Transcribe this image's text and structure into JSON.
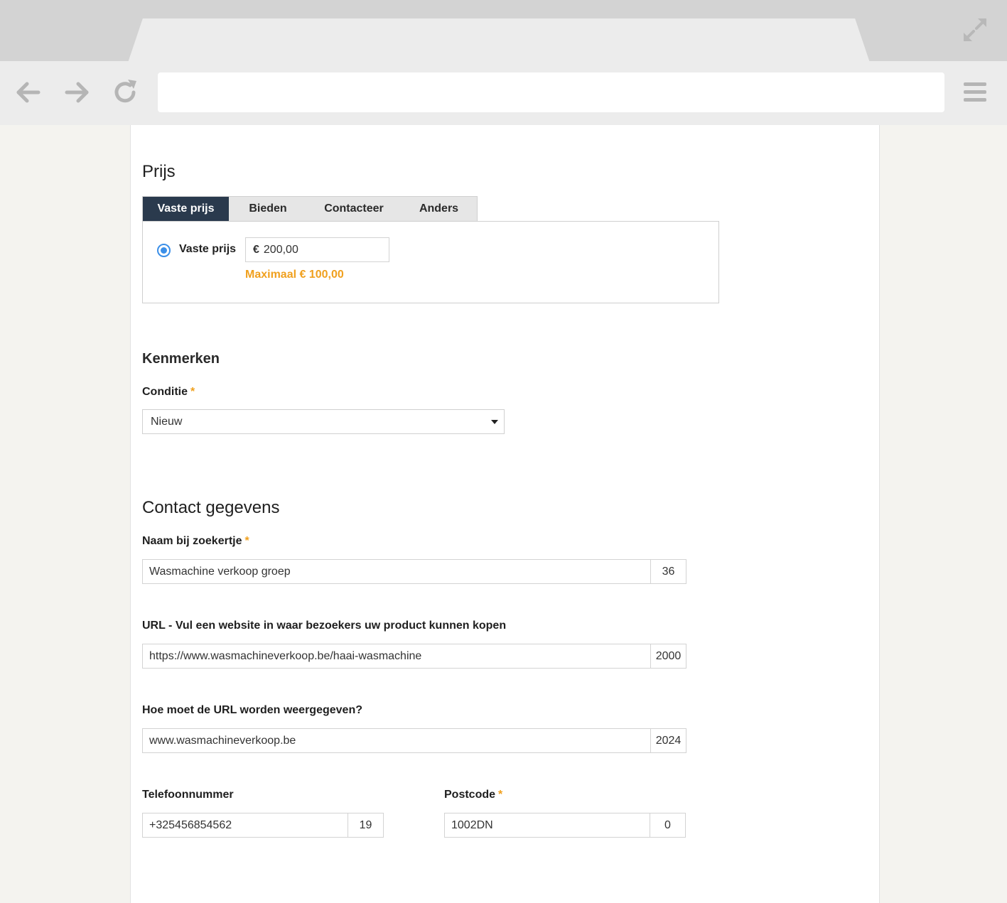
{
  "browser": {
    "icons": [
      "back-arrow-icon",
      "forward-arrow-icon",
      "reload-icon",
      "menu-icon",
      "expand-icon"
    ],
    "address": ""
  },
  "price_section": {
    "title": "Prijs",
    "tabs": [
      {
        "label": "Vaste prijs",
        "active": true
      },
      {
        "label": "Bieden",
        "active": false
      },
      {
        "label": "Contacteer",
        "active": false
      },
      {
        "label": "Anders",
        "active": false
      }
    ],
    "radio_label": "Vaste prijs",
    "currency_symbol": "€",
    "price_value": "200,00",
    "hint": "Maximaal € 100,00"
  },
  "features_section": {
    "title": "Kenmerken",
    "condition_label": "Conditie",
    "required_marker": "*",
    "condition_value": "Nieuw"
  },
  "contact_section": {
    "title": "Contact gegevens",
    "name_label": "Naam bij zoekertje",
    "name_value": "Wasmachine verkoop groep",
    "name_counter": "36",
    "url_label": "URL - Vul een website in waar bezoekers uw product kunnen kopen",
    "url_value": "https://www.wasmachineverkoop.be/haai-wasmachine",
    "url_counter": "2000",
    "display_url_label": "Hoe moet de URL worden weergegeven?",
    "display_url_value": "www.wasmachineverkoop.be",
    "display_url_counter": "2024",
    "phone_label": "Telefoonnummer",
    "phone_value": "+325456854562",
    "phone_counter": "19",
    "postcode_label": "Postcode",
    "postcode_value": "1002DN",
    "postcode_counter": "0"
  },
  "colors": {
    "active_tab": "#2a3a4d",
    "required": "#f0a01e",
    "radio": "#3b8fe8"
  }
}
